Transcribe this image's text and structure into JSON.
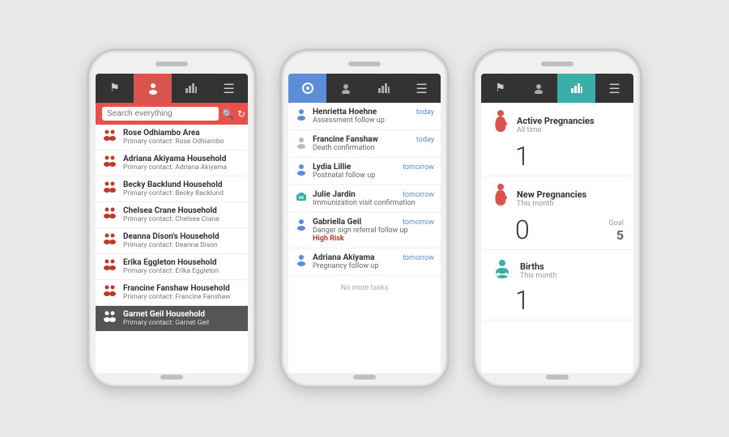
{
  "phone1": {
    "nav": {
      "tab1": "⚑",
      "tab2": "👤",
      "tab3": "📊",
      "tab4": "☰",
      "active": "tab2"
    },
    "search": {
      "placeholder": "Search everything",
      "icon": "🔍",
      "refresh": "↻"
    },
    "contacts": [
      {
        "name": "Rose Odhiambo Area",
        "sub": "Primary contact: Rose Odhiambo"
      },
      {
        "name": "Adriana Akiyama Household",
        "sub": "Primary contact: Adriana Akiyama"
      },
      {
        "name": "Becky Backlund Household",
        "sub": "Primary contact: Becky Backlund"
      },
      {
        "name": "Chelsea Crane Household",
        "sub": "Primary contact: Chelsea Crane"
      },
      {
        "name": "Deanna Dison's Household",
        "sub": "Primary contact: Deanna Dison"
      },
      {
        "name": "Erika Eggleton Household",
        "sub": "Primary contact: Erika Eggleton"
      },
      {
        "name": "Francine Fanshaw Household",
        "sub": "Primary contact: Francine Fanshaw"
      },
      {
        "name": "Garnet Geil Household",
        "sub": "Primary contact: Garnet Geil",
        "selected": true
      }
    ]
  },
  "phone2": {
    "nav": {
      "tab1": "⚑",
      "tab2": "👤",
      "tab3": "📊",
      "tab4": "☰",
      "active": "tab1"
    },
    "tasks": [
      {
        "name": "Henrietta Hoehne",
        "desc": "Assessment follow up",
        "time": "today",
        "iconType": "blue"
      },
      {
        "name": "Francine Fanshaw",
        "desc": "Death confirmation",
        "time": "today",
        "iconType": "gray"
      },
      {
        "name": "Lydia Lillie",
        "desc": "Postnatal follow up",
        "time": "tomorrow",
        "iconType": "blue"
      },
      {
        "name": "Julie Jardin",
        "desc": "Immunization visit confirmation",
        "time": "tomorrow",
        "iconType": "teal"
      },
      {
        "name": "Gabriella Geil",
        "desc": "Danger sign referral follow up",
        "time": "tomorrow",
        "subDesc": "High Risk",
        "iconType": "blue"
      },
      {
        "name": "Adriana Akiyama",
        "desc": "Pregnancy follow up",
        "time": "tomorrow",
        "iconType": "blue"
      }
    ],
    "noMoreTasks": "No more tasks"
  },
  "phone3": {
    "nav": {
      "tab1": "⚑",
      "tab2": "👤",
      "tab3": "📊",
      "tab4": "☰",
      "active": "tab3"
    },
    "stats": [
      {
        "title": "Active Pregnancies",
        "subtitle": "All time",
        "value": "1",
        "iconType": "pregnancy",
        "hasGoal": false
      },
      {
        "title": "New Pregnancies",
        "subtitle": "This month",
        "value": "0",
        "iconType": "pregnancy",
        "hasGoal": true,
        "goalLabel": "Goal",
        "goalValue": "5"
      },
      {
        "title": "Births",
        "subtitle": "This month",
        "value": "1",
        "iconType": "birth",
        "hasGoal": false
      }
    ]
  }
}
